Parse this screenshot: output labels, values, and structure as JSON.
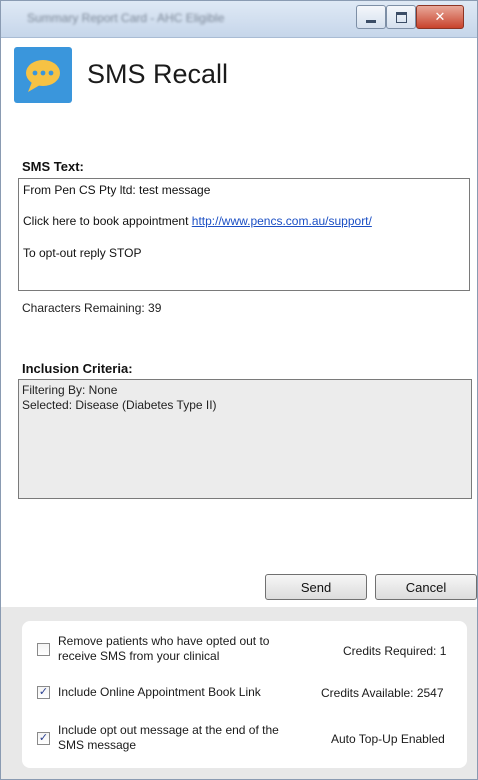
{
  "window": {
    "title": "Summary Report Card - AHC Eligible",
    "min_icon": "minimize-icon",
    "max_icon": "maximize-icon",
    "close_icon": "close-icon",
    "close_glyph": "✕"
  },
  "header": {
    "app_icon": "chat-bubble-icon",
    "title": "SMS Recall",
    "icon_color": "#3a96dc",
    "bubble_color": "#f6c244"
  },
  "sms": {
    "label": "SMS Text:",
    "line1": "From Pen CS Pty ltd: test message",
    "line2_prefix": "Click here to book appointment ",
    "line2_link": "http://www.pencs.com.au/support/",
    "line3": "To opt-out reply STOP",
    "chars_remaining": "Characters Remaining: 39"
  },
  "inclusion": {
    "label": "Inclusion Criteria:",
    "line1": "Filtering By: None",
    "line2": "Selected: Disease (Diabetes Type II)"
  },
  "buttons": {
    "send": "Send",
    "cancel": "Cancel"
  },
  "options": [
    {
      "label": "Remove patients who have opted out to receive SMS from your clinical",
      "checked": false
    },
    {
      "label": "Include Online Appointment Book Link",
      "checked": true
    },
    {
      "label": "Include opt out message at the end of the SMS message",
      "checked": true
    }
  ],
  "credits": {
    "required": "Credits Required: 1",
    "available": "Credits Available: 2547",
    "topup": "Auto Top-Up Enabled"
  },
  "check_glyph": "✓"
}
